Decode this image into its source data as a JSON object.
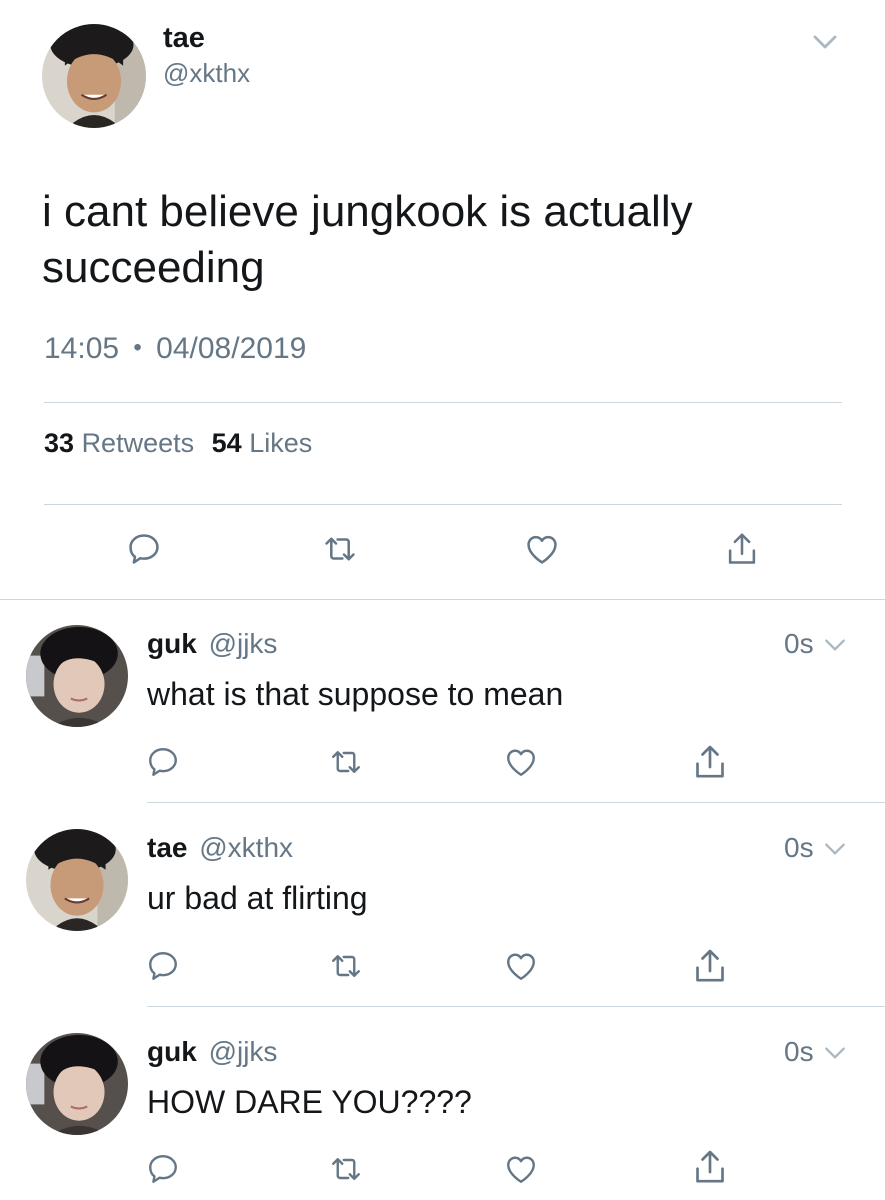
{
  "main_tweet": {
    "name": "tae",
    "handle": "@xkthx",
    "text": "i cant believe jungkook is actually succeeding",
    "time": "14:05",
    "separator": "•",
    "date": "04/08/2019",
    "retweets_count": "33",
    "retweets_label": "Retweets",
    "likes_count": "54",
    "likes_label": "Likes"
  },
  "replies": [
    {
      "name": "guk",
      "handle": "@jjks",
      "text": "what is that suppose to mean",
      "time": "0s",
      "avatar": "guk"
    },
    {
      "name": "tae",
      "handle": "@xkthx",
      "text": "ur bad at flirting",
      "time": "0s",
      "avatar": "tae"
    },
    {
      "name": "guk",
      "handle": "@jjks",
      "text": "HOW DARE YOU????",
      "time": "0s",
      "avatar": "guk"
    }
  ],
  "icons": {
    "reply": "reply-icon",
    "retweet": "retweet-icon",
    "like": "heart-icon",
    "share": "share-icon",
    "more": "chevron-down-icon"
  },
  "colors": {
    "text": "#14171a",
    "secondary": "#657786",
    "divider": "#ccd6dd",
    "icon": "#657786"
  }
}
